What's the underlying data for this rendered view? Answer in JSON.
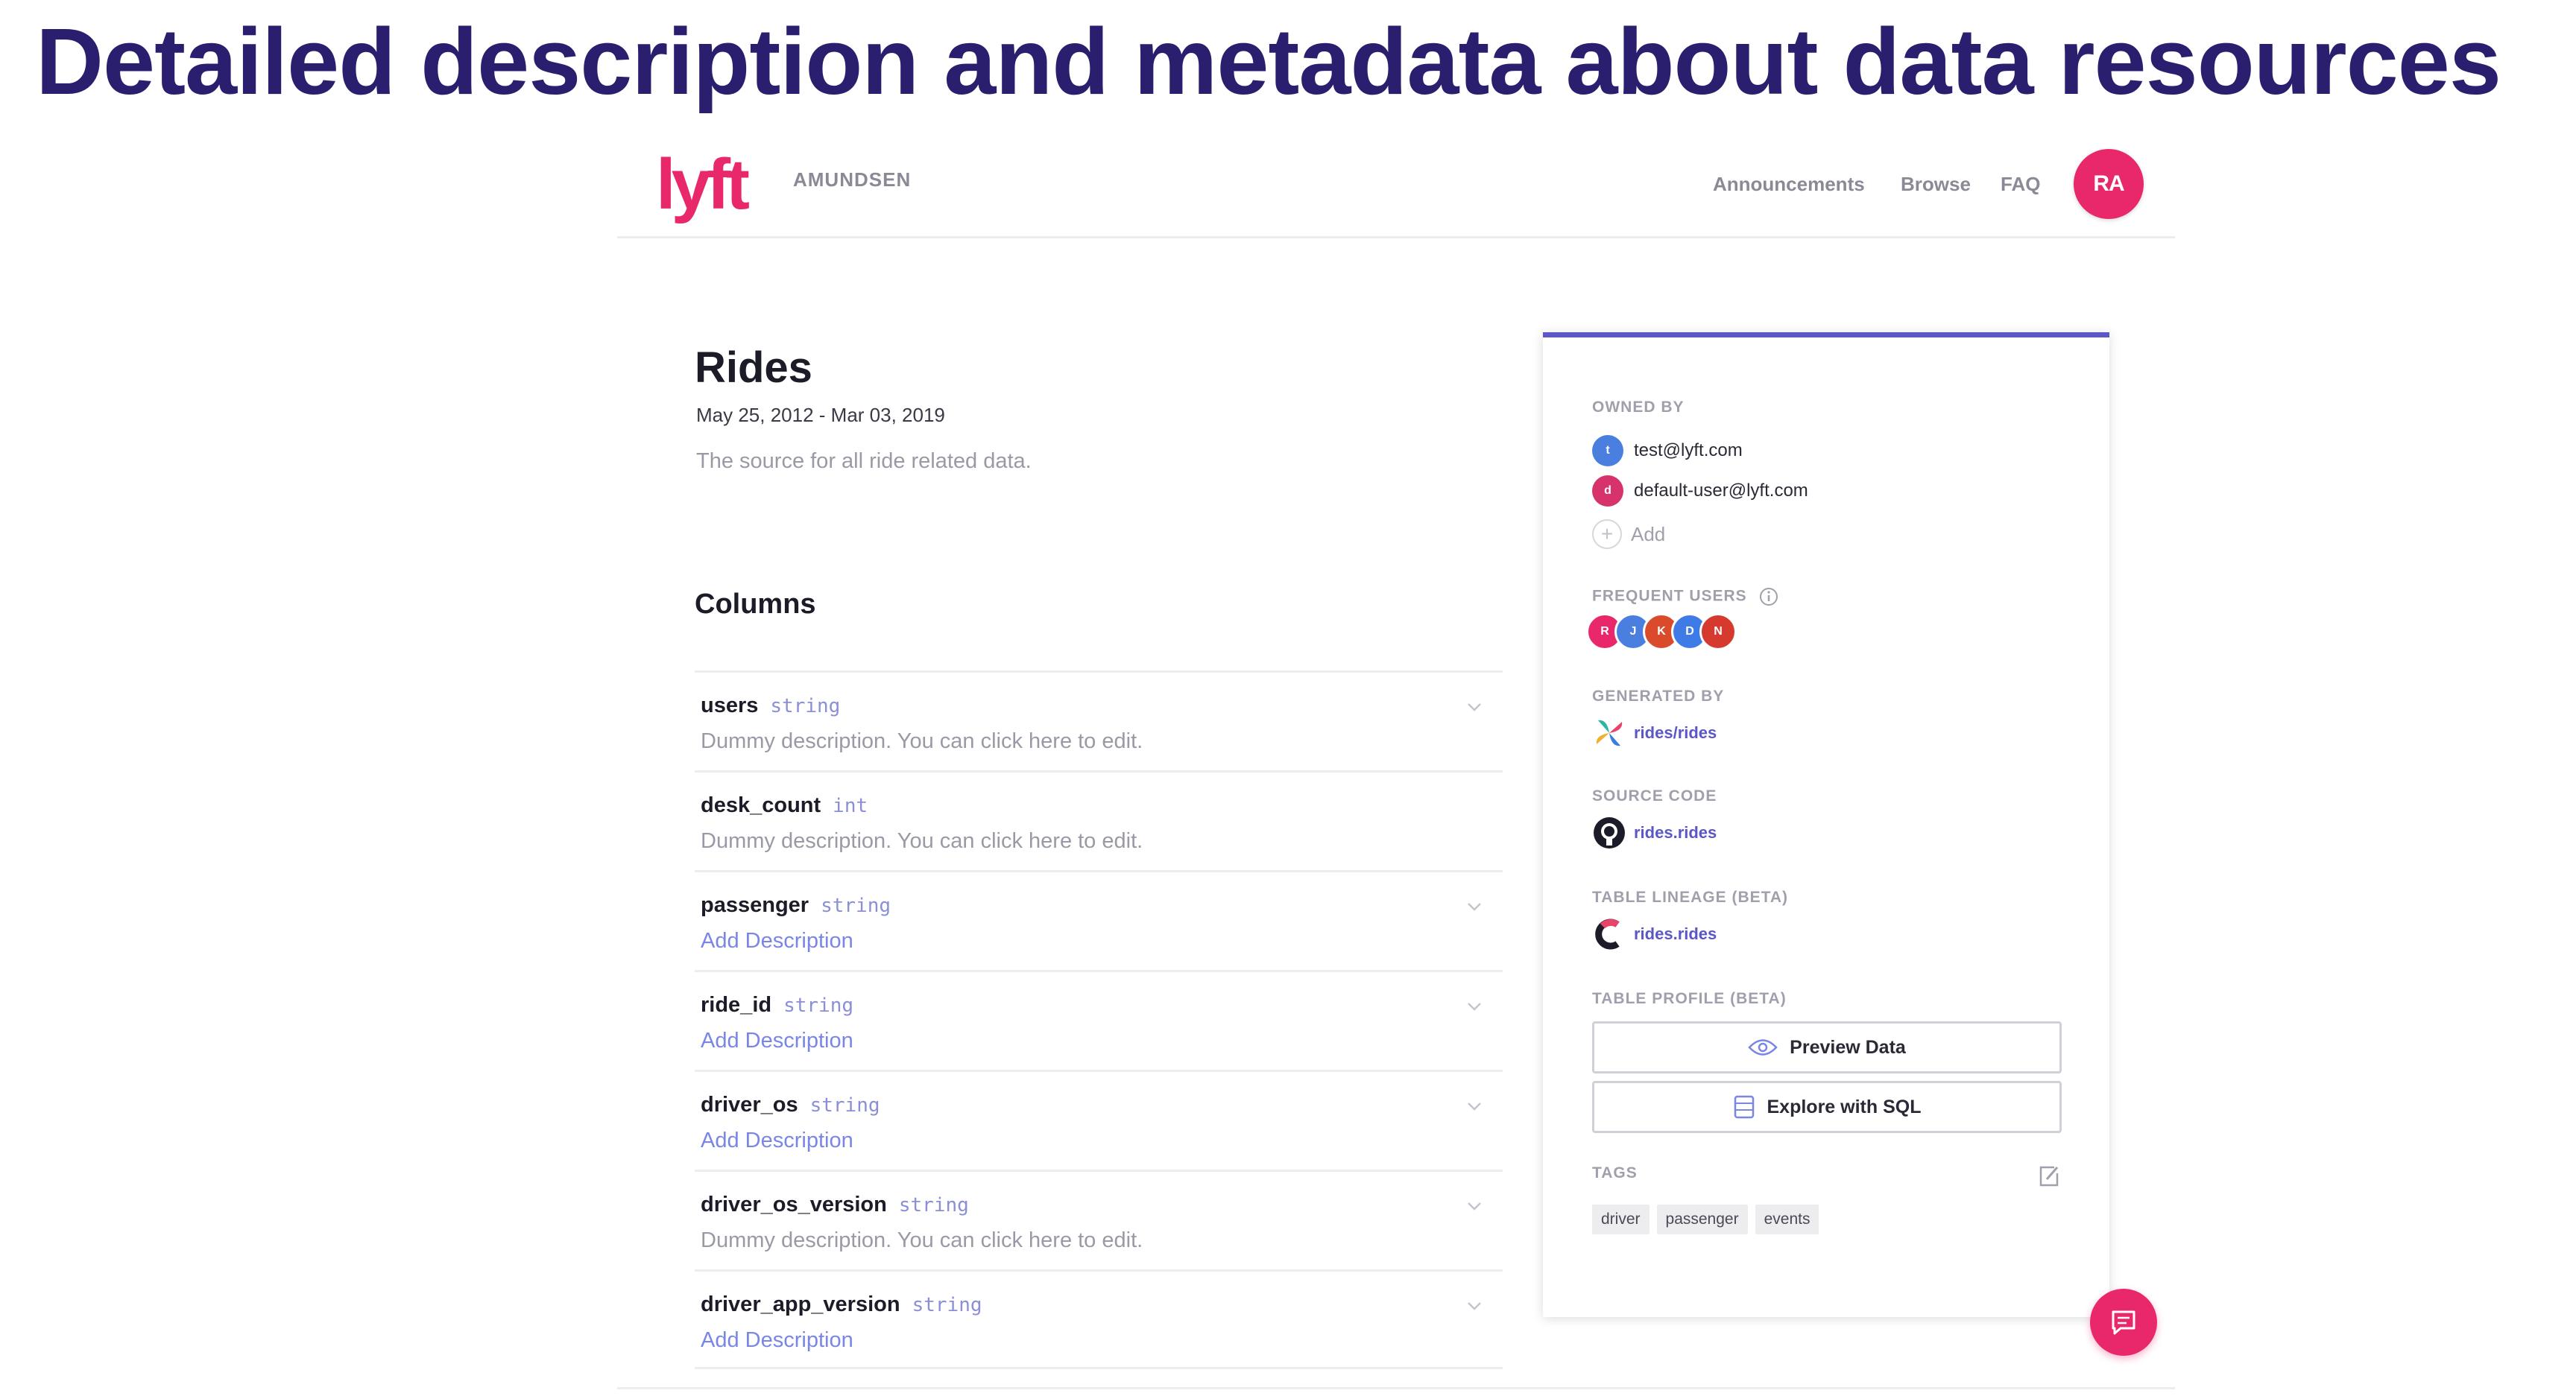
{
  "slide": {
    "title": "Detailed description and metadata about data resources"
  },
  "header": {
    "logo": "lyft",
    "brand": "AMUNDSEN",
    "nav": [
      "Announcements",
      "Browse",
      "FAQ"
    ],
    "avatar_initials": "RA",
    "accent": "#e8286a"
  },
  "table": {
    "name": "Rides",
    "date_range": "May 25, 2012 - Mar 03, 2019",
    "description": "The source for all ride related data."
  },
  "columns_heading": "Columns",
  "columns": [
    {
      "name": "users",
      "type": "string",
      "description": "Dummy description. You can click here to edit."
    },
    {
      "name": "desk_count",
      "type": "int",
      "description": "Dummy description. You can click here to edit."
    },
    {
      "name": "passenger",
      "type": "string",
      "description": "Add Description"
    },
    {
      "name": "ride_id",
      "type": "string",
      "description": "Add Description"
    },
    {
      "name": "driver_os",
      "type": "string",
      "description": "Add Description"
    },
    {
      "name": "driver_os_version",
      "type": "string",
      "description": "Dummy description. You can click here to edit."
    },
    {
      "name": "driver_app_version",
      "type": "string",
      "description": "Add Description"
    }
  ],
  "panel": {
    "accent": "#5b57c8",
    "owned_by_label": "OWNED BY",
    "owners": [
      {
        "email": "test@lyft.com",
        "initial": "t",
        "color": "#4a7fe0"
      },
      {
        "email": "default-user@lyft.com",
        "initial": "d",
        "color": "#d6336c"
      }
    ],
    "add_label": "Add",
    "frequent_users_label": "FREQUENT USERS",
    "frequent_users": [
      {
        "initial": "R",
        "color": "#e8286a"
      },
      {
        "initial": "J",
        "color": "#4a7fe0"
      },
      {
        "initial": "K",
        "color": "#d94b2b"
      },
      {
        "initial": "D",
        "color": "#3f7be6"
      },
      {
        "initial": "N",
        "color": "#d63a2f"
      }
    ],
    "generated_by_label": "GENERATED BY",
    "generated_by": "rides/rides",
    "source_code_label": "SOURCE CODE",
    "source_code": "rides.rides",
    "lineage_label": "TABLE LINEAGE (BETA)",
    "lineage": "rides.rides",
    "profile_label": "TABLE PROFILE (BETA)",
    "preview_button": "Preview Data",
    "explore_button": "Explore with SQL",
    "tags_label": "TAGS",
    "tags": [
      "driver",
      "passenger",
      "events"
    ]
  }
}
